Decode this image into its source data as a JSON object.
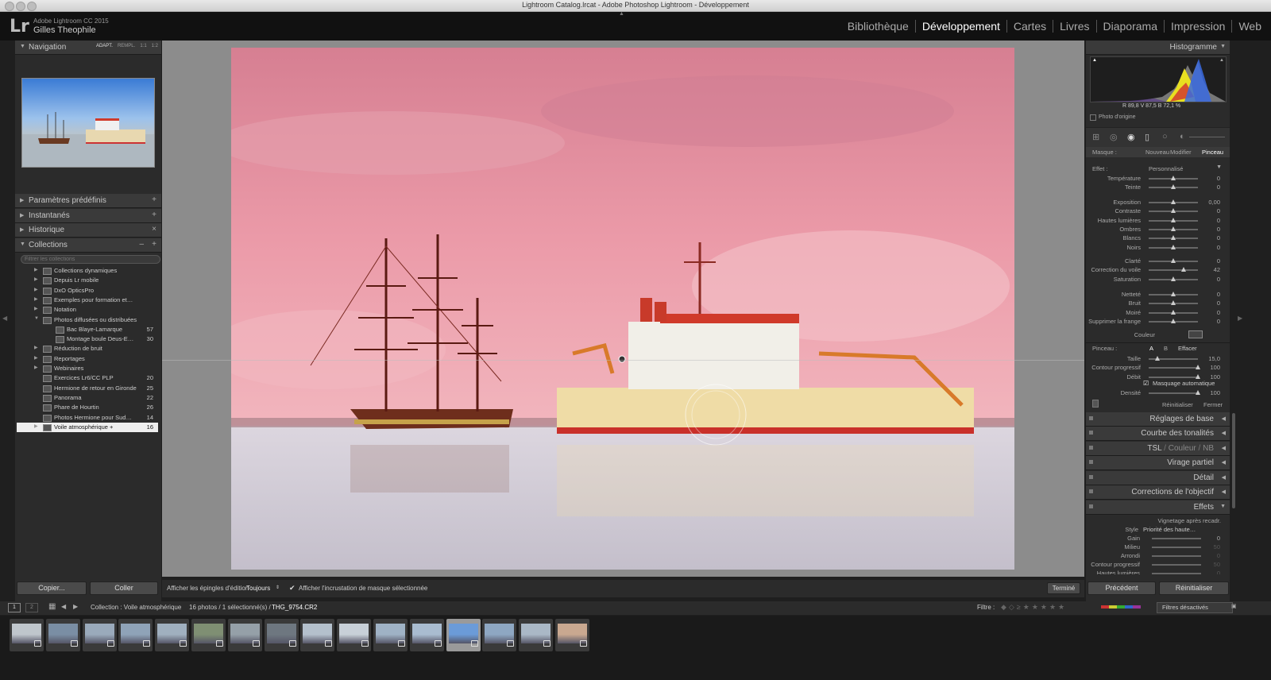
{
  "window": {
    "title": "Lightroom Catalog.lrcat - Adobe Photoshop Lightroom - Développement"
  },
  "header": {
    "logo": "Lr",
    "app_name": "Adobe Lightroom CC 2015",
    "user_name": "Gilles Theophile",
    "modules": [
      "Bibliothèque",
      "Développement",
      "Cartes",
      "Livres",
      "Diaporama",
      "Impression",
      "Web"
    ],
    "active_module": "Développement"
  },
  "left_panel": {
    "navigator": {
      "label": "Navigation",
      "zoom_options": [
        "ADAPT.",
        "REMPL.",
        "1:1",
        "1:2"
      ]
    },
    "presets": {
      "label": "Paramètres prédéfinis",
      "action": "+"
    },
    "snapshots": {
      "label": "Instantanés",
      "action": "+"
    },
    "history": {
      "label": "Historique",
      "action": "×"
    },
    "collections": {
      "label": "Collections",
      "actions": [
        "–",
        "+"
      ],
      "search_placeholder": "Filtrer les collections",
      "items": [
        {
          "name": "Collections dynamiques",
          "count": "",
          "level": 1,
          "arrow": "▶"
        },
        {
          "name": "Depuis Lr mobile",
          "count": "",
          "level": 1,
          "arrow": "▶"
        },
        {
          "name": "DxO OpticsPro",
          "count": "",
          "level": 1,
          "arrow": "▶"
        },
        {
          "name": "Exemples pour formation et…",
          "count": "",
          "level": 1,
          "arrow": "▶"
        },
        {
          "name": "Notation",
          "count": "",
          "level": 1,
          "arrow": "▶"
        },
        {
          "name": "Photos diffusées ou distribuées",
          "count": "",
          "level": 1,
          "arrow": "▼"
        },
        {
          "name": "Bac Blaye-Lamarque",
          "count": "57",
          "level": 2,
          "arrow": ""
        },
        {
          "name": "Montage boule Deus-E…",
          "count": "30",
          "level": 2,
          "arrow": ""
        },
        {
          "name": "Réduction de bruit",
          "count": "",
          "level": 1,
          "arrow": "▶"
        },
        {
          "name": "Reportages",
          "count": "",
          "level": 1,
          "arrow": "▶"
        },
        {
          "name": "Webinaires",
          "count": "",
          "level": 1,
          "arrow": "▶"
        },
        {
          "name": "Exercices Lr6/CC PLP",
          "count": "20",
          "level": 0,
          "arrow": ""
        },
        {
          "name": "Hermione de retour en Gironde",
          "count": "25",
          "level": 0,
          "arrow": ""
        },
        {
          "name": "Panorama",
          "count": "22",
          "level": 0,
          "arrow": ""
        },
        {
          "name": "Phare de Hourtin",
          "count": "26",
          "level": 0,
          "arrow": ""
        },
        {
          "name": "Photos Hermione pour Sud…",
          "count": "14",
          "level": 0,
          "arrow": ""
        },
        {
          "name": "Voile atmosphérique +",
          "count": "16",
          "level": 0,
          "arrow": "▶",
          "selected": true
        }
      ]
    },
    "copy_button": "Copier...",
    "paste_button": "Coller"
  },
  "toolbar": {
    "pins_label": "Afficher les épingles d'édition :",
    "pins_value": "Toujours",
    "overlay_label": "Afficher l'incrustation de masque sélectionnée",
    "done_button": "Terminé"
  },
  "right_panel": {
    "histogram": {
      "label": "Histogramme",
      "readout": "R  89,8  V  87,5  B  72,1 %",
      "original_photo": "Photo d'origine"
    },
    "mask": {
      "label": "Masque :",
      "options": [
        "Nouveau",
        "Modifier",
        "Pinceau"
      ],
      "active": "Pinceau"
    },
    "effect": {
      "label": "Effet :",
      "value": "Personnalisé"
    },
    "sliders_group1": [
      {
        "label": "Température",
        "value": "0",
        "pos": 0.5
      },
      {
        "label": "Teinte",
        "value": "0",
        "pos": 0.5
      }
    ],
    "sliders_group2": [
      {
        "label": "Exposition",
        "value": "0,00",
        "pos": 0.5
      },
      {
        "label": "Contraste",
        "value": "0",
        "pos": 0.5
      },
      {
        "label": "Hautes lumières",
        "value": "0",
        "pos": 0.5
      },
      {
        "label": "Ombres",
        "value": "0",
        "pos": 0.5
      },
      {
        "label": "Blancs",
        "value": "0",
        "pos": 0.5
      },
      {
        "label": "Noirs",
        "value": "0",
        "pos": 0.5
      }
    ],
    "sliders_group3": [
      {
        "label": "Clarté",
        "value": "0",
        "pos": 0.5
      },
      {
        "label": "Correction du voile",
        "value": "42",
        "pos": 0.71
      },
      {
        "label": "Saturation",
        "value": "0",
        "pos": 0.5
      }
    ],
    "sliders_group4": [
      {
        "label": "Netteté",
        "value": "0",
        "pos": 0.5
      },
      {
        "label": "Bruit",
        "value": "0",
        "pos": 0.5
      },
      {
        "label": "Moiré",
        "value": "0",
        "pos": 0.5
      },
      {
        "label": "Supprimer la frange",
        "value": "0",
        "pos": 0.5
      }
    ],
    "color_label": "Couleur",
    "brush": {
      "label": "Pinceau :",
      "a": "A",
      "b": "B",
      "erase": "Effacer"
    },
    "brush_sliders": [
      {
        "label": "Taille",
        "value": "15,0",
        "pos": 0.18
      },
      {
        "label": "Contour progressif",
        "value": "100",
        "pos": 1
      },
      {
        "label": "Débit",
        "value": "100",
        "pos": 1
      }
    ],
    "auto_mask": "Masquage automatique",
    "density": {
      "label": "Densité",
      "value": "100",
      "pos": 1
    },
    "reset_button": "Réinitialiser",
    "close_button": "Fermer",
    "sections": [
      "Réglages de base",
      "Courbe des tonalités",
      "TSL",
      "Couleur",
      "NB",
      "Virage partiel",
      "Détail",
      "Corrections de l'objectif",
      "Effets"
    ],
    "effects": {
      "vignette_title": "Vignetage après recadr.",
      "style_label": "Style",
      "style_value": "Priorité des haute…",
      "rows": [
        {
          "label": "Gain",
          "value": "0"
        },
        {
          "label": "Milieu",
          "value": "50"
        },
        {
          "label": "Arrondi",
          "value": "0"
        },
        {
          "label": "Contour progressif",
          "value": "50"
        },
        {
          "label": "Hautes lumières",
          "value": "0"
        }
      ]
    },
    "previous_button": "Précédent",
    "reset_all_button": "Réinitialiser"
  },
  "filmstrip": {
    "pages": [
      "1",
      "2"
    ],
    "source": "Collection : Voile atmosphérique",
    "count": "16 photos / 1 sélectionné(s) /",
    "file": "THG_9754.CR2",
    "filter_label": "Filtre :",
    "filter_value": "Filtres désactivés",
    "thumb_count": 16,
    "selected_index": 12
  },
  "colors": {
    "mask_overlay": "#f08ca0",
    "accent": "#ffffff",
    "panel": "#2b2b2b"
  }
}
